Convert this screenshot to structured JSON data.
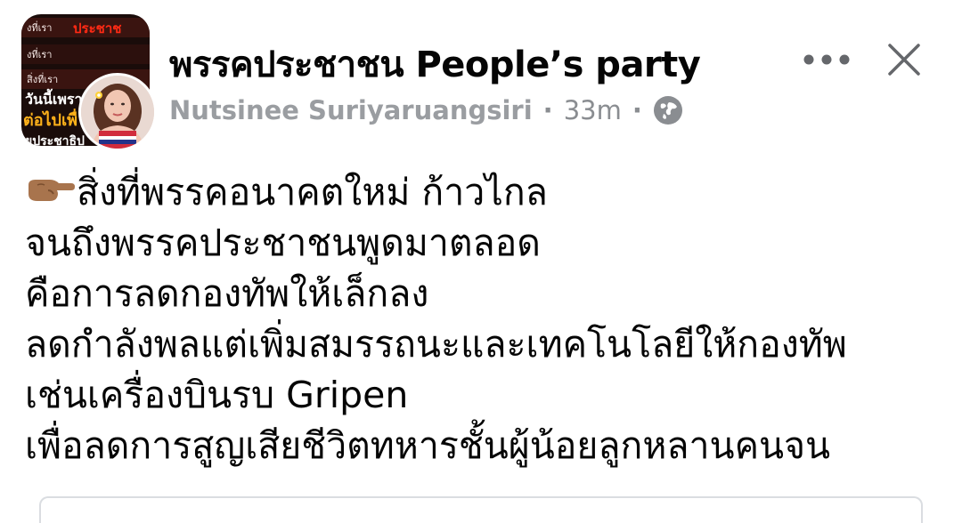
{
  "header": {
    "group_name": "พรรคประชาชน People’s party",
    "author": "Nutsinee Suriyaruangsiri",
    "separator": "·",
    "time": "33m",
    "privacy_icon": "globe-icon",
    "more_icon": "more-horizontal-icon",
    "close_icon": "close-icon"
  },
  "thumbnail": {
    "lines": [
      "งที่เรา",
      "งที่เรา",
      "สิ่งที่เรา",
      "วันนี้เพราะ",
      "ต่อไปเพื่",
      "ยประชาธิป"
    ],
    "highlight": "ประชาช"
  },
  "post": {
    "lead_icon": "backhand-index-pointing-right-emoji",
    "lines": [
      "สิ่งที่พรรคอนาคตใหม่ ก้าวไกล",
      "จนถึงพรรคประชาชนพูดมาตลอด",
      "คือการลดกองทัพให้เล็กลง",
      "ลดกำลังพลแต่เพิ่มสมรรถนะและเทคโนโลยีให้กองทัพ",
      "เช่นเครื่องบินรบ Gripen",
      "เพื่อลดการสูญเสียชีวิตทหารชั้นผู้น้อยลูกหลานคนจน"
    ]
  },
  "colors": {
    "text": "#050505",
    "meta": "#8a8d91",
    "icon": "#65676b",
    "divider": "#dadde1"
  }
}
